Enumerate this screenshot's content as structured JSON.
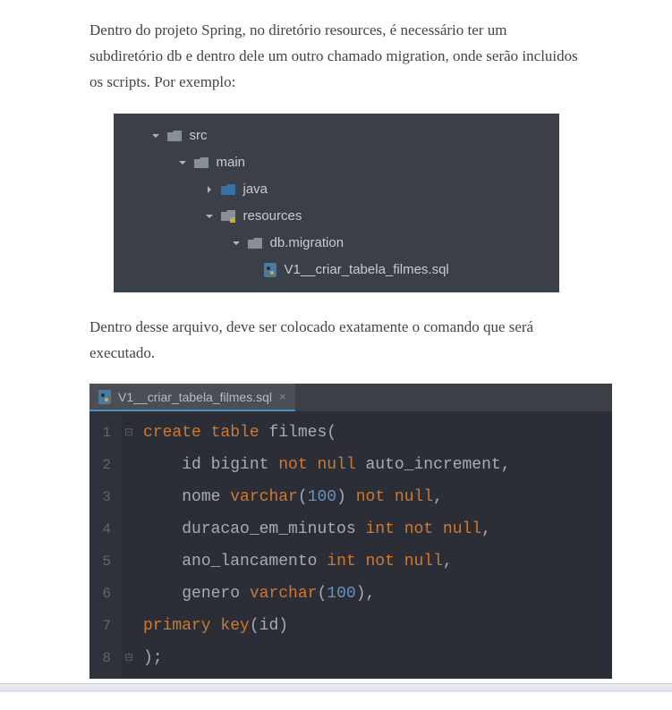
{
  "paragraphs": {
    "p1": "Dentro do projeto Spring, no diretório resources, é necessário ter um subdiretório db e dentro dele um outro chamado migration, onde serão incluidos os scripts. Por exemplo:",
    "p2": "Dentro desse arquivo, deve ser colocado exatamente o comando que será executado."
  },
  "tree": {
    "items": [
      {
        "label": "src"
      },
      {
        "label": "main"
      },
      {
        "label": "java"
      },
      {
        "label": "resources"
      },
      {
        "label": "db.migration"
      },
      {
        "label": "V1__criar_tabela_filmes.sql"
      }
    ]
  },
  "editor": {
    "tab_label": "V1__criar_tabela_filmes.sql",
    "lines": {
      "l1_kw1": "create",
      "l1_kw2": "table",
      "l1_ident": "filmes",
      "l1_paren": "(",
      "l2_id": "id bigint",
      "l2_nn": "not null",
      "l2_ai": "auto_increment",
      "l2_comma": ",",
      "l3_nome": "nome",
      "l3_varchar": "varchar",
      "l3_open": "(",
      "l3_num": "100",
      "l3_close": ")",
      "l3_nn": "not null",
      "l3_comma": ",",
      "l4_dur": "duracao_em_minutos",
      "l4_int": "int",
      "l4_nn": "not null",
      "l4_comma": ",",
      "l5_ano": "ano_lancamento",
      "l5_int": "int",
      "l5_nn": "not null",
      "l5_comma": ",",
      "l6_gen": "genero",
      "l6_varchar": "varchar",
      "l6_open": "(",
      "l6_num": "100",
      "l6_close": ")",
      "l6_comma": ",",
      "l7_pk": "primary key",
      "l7_open": "(",
      "l7_id": "id",
      "l7_close": ")",
      "l8_close": ");"
    },
    "line_numbers": [
      "1",
      "2",
      "3",
      "4",
      "5",
      "6",
      "7",
      "8"
    ]
  }
}
